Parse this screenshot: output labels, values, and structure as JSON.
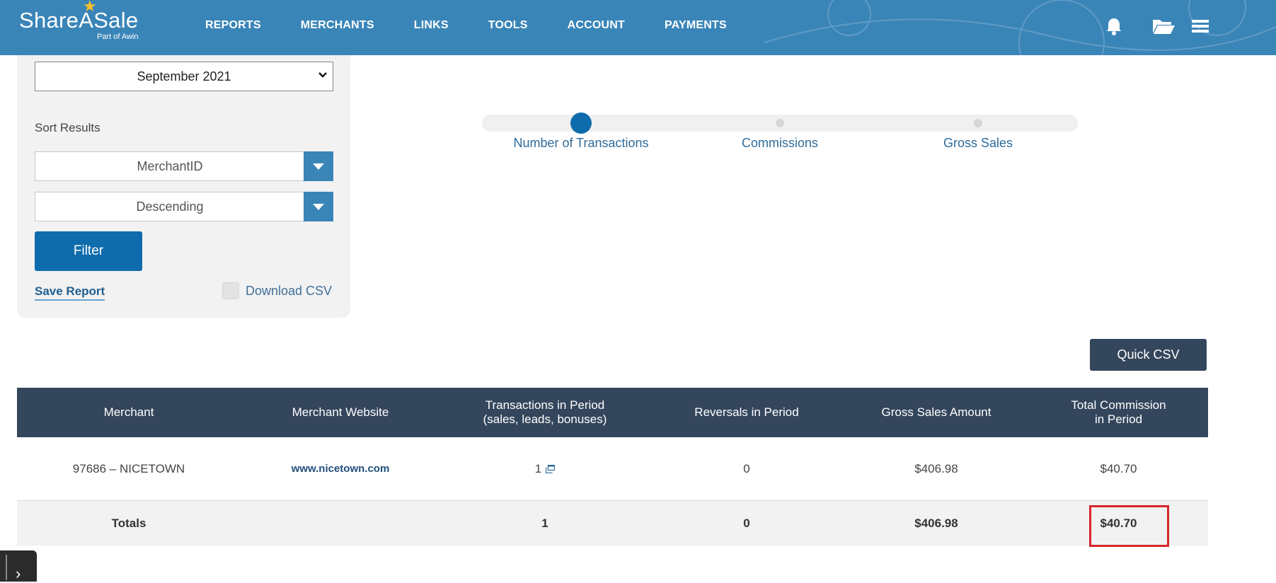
{
  "header": {
    "brand": "ShareASale",
    "brand_sub": "Part of Awin",
    "nav": [
      "REPORTS",
      "MERCHANTS",
      "LINKS",
      "TOOLS",
      "ACCOUNT",
      "PAYMENTS"
    ],
    "icons": [
      "bell-icon",
      "folder-open-icon",
      "hamburger-menu-icon"
    ],
    "color": "#3a85b8"
  },
  "sidebar": {
    "period_value": "September 2021",
    "sort_label": "Sort Results",
    "sort_by": "MerchantID",
    "sort_order": "Descending",
    "filter_label": "Filter",
    "save_report_label": "Save Report",
    "download_csv_label": "Download CSV"
  },
  "metric_slider": {
    "stops": [
      "Number of Transactions",
      "Commissions",
      "Gross Sales"
    ],
    "active_index": 0
  },
  "quick_csv_label": "Quick CSV",
  "table": {
    "headers": [
      "Merchant",
      "Merchant Website",
      "Transactions in Period\n(sales, leads, bonuses)",
      "Reversals in Period",
      "Gross Sales Amount",
      "Total Commission\nin Period"
    ],
    "rows": [
      {
        "merchant": "97686 – NICETOWN",
        "website": "www.nicetown.com",
        "transactions": "1",
        "reversals": "0",
        "gross_sales": "$406.98",
        "commission": "$40.70"
      }
    ],
    "totals": {
      "label": "Totals",
      "website": "",
      "transactions": "1",
      "reversals": "0",
      "gross_sales": "$406.98",
      "commission": "$40.70"
    }
  },
  "colors": {
    "accent": "#0f6cac",
    "table_header": "#34465c",
    "highlight": "#d6262b"
  }
}
